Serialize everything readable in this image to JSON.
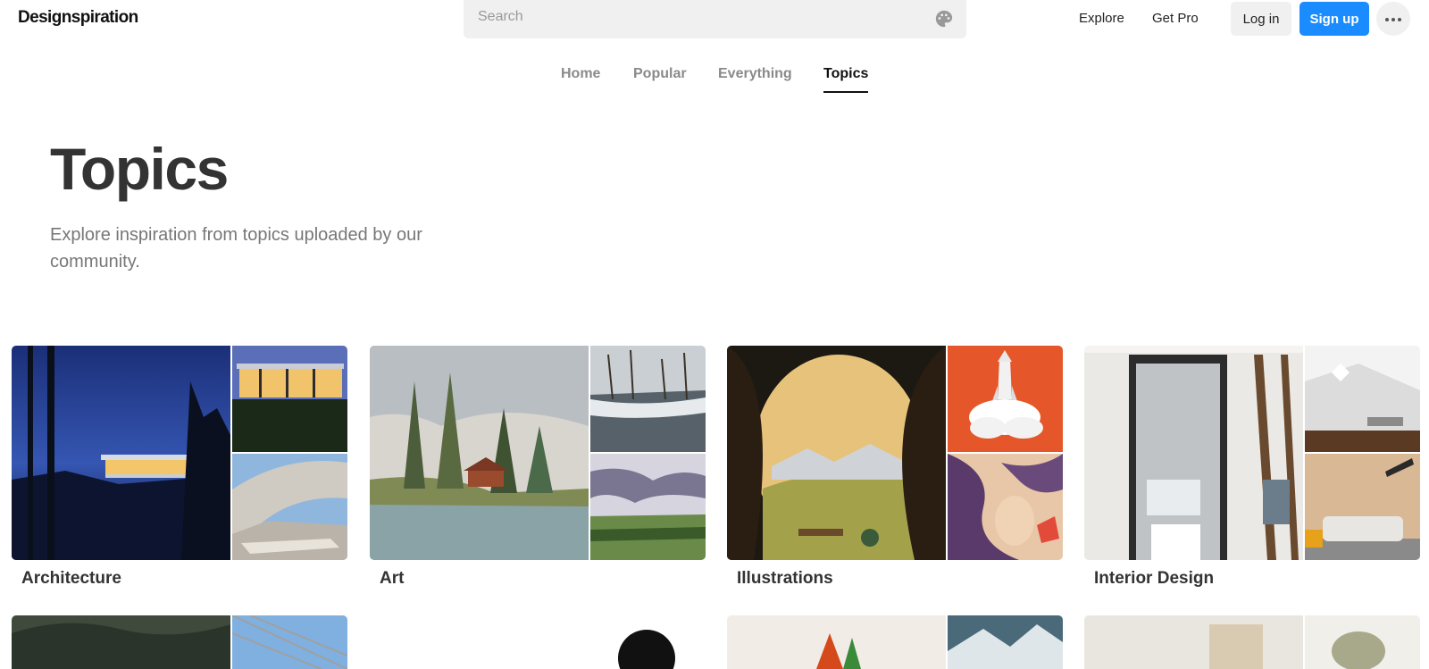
{
  "header": {
    "logo": "Designspiration",
    "search_placeholder": "Search",
    "nav": [
      "Explore",
      "Get Pro"
    ],
    "login_label": "Log in",
    "signup_label": "Sign up"
  },
  "tabs": [
    {
      "label": "Home",
      "active": false
    },
    {
      "label": "Popular",
      "active": false
    },
    {
      "label": "Everything",
      "active": false
    },
    {
      "label": "Topics",
      "active": true
    }
  ],
  "hero": {
    "title": "Topics",
    "subtitle": "Explore inspiration from topics uploaded by our community."
  },
  "topics": [
    {
      "label": "Architecture"
    },
    {
      "label": "Art"
    },
    {
      "label": "Illustrations"
    },
    {
      "label": "Interior Design"
    }
  ],
  "colors": {
    "accent": "#1a8cff",
    "text_dark": "#333333",
    "text_muted": "#777777"
  },
  "icons": {
    "palette": "palette-icon",
    "more": "more-dots-icon"
  }
}
